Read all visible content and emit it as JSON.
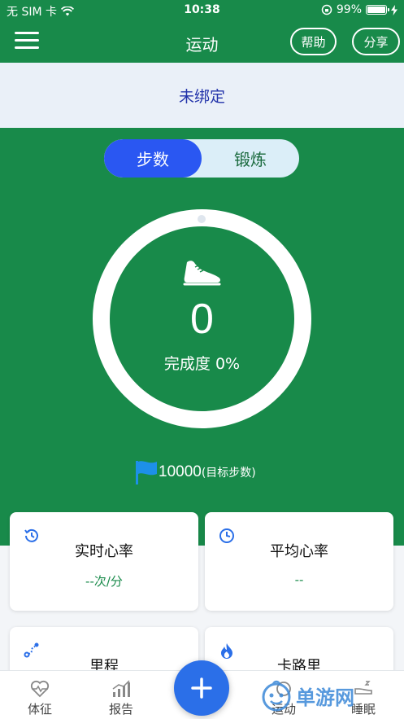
{
  "status_bar": {
    "carrier": "无 SIM 卡",
    "time": "10:38",
    "battery": "99%"
  },
  "nav": {
    "title": "运动",
    "help_label": "帮助",
    "share_label": "分享"
  },
  "device": {
    "bind_status": "未绑定"
  },
  "segment": {
    "steps_label": "步数",
    "exercise_label": "锻炼"
  },
  "progress": {
    "steps": "0",
    "completion_text": "完成度 0%"
  },
  "goal": {
    "value": "10000",
    "unit": "(目标步数)"
  },
  "cards": [
    {
      "title": "实时心率",
      "value": "--次/分"
    },
    {
      "title": "平均心率",
      "value": "--"
    },
    {
      "title": "里程"
    },
    {
      "title": "卡路里"
    }
  ],
  "tabs": [
    {
      "label": "体征"
    },
    {
      "label": "报告"
    },
    {
      "label": "运动"
    },
    {
      "label": "睡眠"
    }
  ],
  "watermark": {
    "text": "单游网"
  },
  "colors": {
    "primary_green": "#188a4a",
    "accent_blue": "#2a57f2",
    "fab_blue": "#2b6fe8",
    "icon_blue": "#2b6fe8",
    "bind_text": "#2233aa"
  }
}
